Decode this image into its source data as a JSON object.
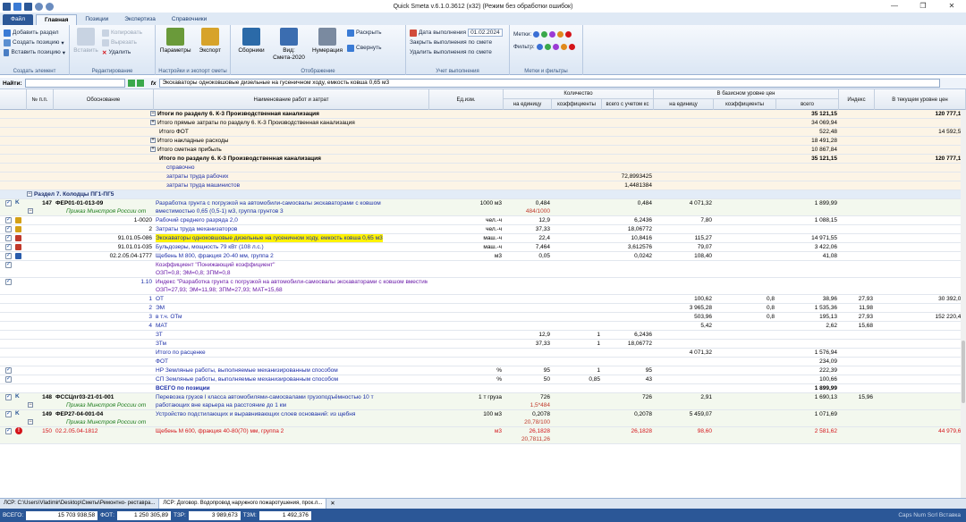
{
  "window": {
    "title": "Quick Smeta v.6.1.0.3612 (x32) (Режим без обработки ошибок)"
  },
  "ribbon_tabs": [
    "Файл",
    "Главная",
    "Позиции",
    "Экспертиза",
    "Справочники"
  ],
  "ribbon": {
    "g1": {
      "name": "Создать элемент",
      "b1": "Добавить раздел",
      "b2": "Создать позицию",
      "b3": "Вставить позицию"
    },
    "g2": {
      "name": "Редактирование",
      "paste": "Вставить",
      "copy": "Копировать",
      "cut": "Вырезать",
      "del": "Удалить"
    },
    "g3": {
      "name": "Настройки и экспорт сметы",
      "params": "Параметры",
      "export": "Экспорт"
    },
    "g4": {
      "name": "Отображение",
      "coll": "Сборники",
      "view": "Вид:",
      "view_val": "Смета-2020",
      "num": "Нумерация",
      "expand": "Раскрыть",
      "collapse": "Свернуть"
    },
    "g5": {
      "name": "Учет выполнения",
      "date_label": "Дата выполнения",
      "date_val": "01.02.2024",
      "close": "Закрыть выполнения по смете",
      "remove": "Удалить выполнения по смете"
    },
    "g6": {
      "name": "Метки и фильтры",
      "marks": "Метки:",
      "filter": "Фильтр:"
    }
  },
  "find": {
    "label": "Найти:",
    "fx": "fx",
    "formula": "Экскаваторы одноковшовые дизельные на гусеничном ходу, емкость ковша 0,65 м3"
  },
  "headers": {
    "num": "№ п.п.",
    "basis": "Обоснование",
    "name": "Наименование работ и затрат",
    "unit": "Ед.изм.",
    "qty": "Количество",
    "qty_unit": "на единицу",
    "qty_coef": "коэффициенты",
    "qty_total": "всего с учетом кс",
    "base": "В базисном уровне цен",
    "base_unit": "на единицу",
    "base_coef": "коэффициенты",
    "base_total": "всего",
    "index": "Индекс",
    "cur": "В текущем уровне цен"
  },
  "rows": [
    {
      "t": "s",
      "name": "Итоги по разделу 6. К-3 Производственная канализация",
      "bt": "35 121,15",
      "cur": "120 777,15",
      "bold": true,
      "exp": "-"
    },
    {
      "t": "s",
      "name": "Итого прямые затраты по разделу 6. К-3 Производственная канализация",
      "bt": "34 069,94",
      "exp": "+"
    },
    {
      "t": "s",
      "name": "Итого ФОТ",
      "bt": "522,48",
      "cur": "14 592,51"
    },
    {
      "t": "s",
      "name": "Итого накладные расходы",
      "bt": "18 491,28",
      "exp": "+"
    },
    {
      "t": "s",
      "name": "Итого сметная прибыль",
      "bt": "10 867,84",
      "exp": "+"
    },
    {
      "t": "s",
      "name": "Итого по разделу 6. К-3 Производственная канализация",
      "bt": "35 121,15",
      "cur": "120 777,15",
      "bold": true
    },
    {
      "t": "ref",
      "name": "справочно"
    },
    {
      "t": "ref",
      "name": "затраты труда рабочих",
      "qt": "72,8993425"
    },
    {
      "t": "ref",
      "name": "затраты труда машинистов",
      "qt": "1,4481384"
    },
    {
      "t": "sec",
      "name": "Раздел 7. Колодцы ПГ1-ПГ5"
    },
    {
      "t": "pos",
      "num": "147",
      "basis": "ФЕР01-01-013-09",
      "sub": "Приказ Минстроя России от",
      "name": "Разработка грунта с погрузкой на автомобили-самосвалы экскаваторами с ковшом",
      "name2": "вместимостью 0,65 (0,5-1) м3, группа грунтов 3",
      "unit": "1000 м3",
      "qu": "0,484",
      "qu2": "484/1000",
      "qt": "0,484",
      "bu": "4 071,32",
      "bt": "1 899,99",
      "h": 2
    },
    {
      "t": "res",
      "basis": "1-0020",
      "name": "Рабочий среднего разряда 2,0",
      "unit": "чел.-ч",
      "qu": "12,9",
      "qt": "6,2436",
      "bu": "7,80",
      "bt": "1 088,15",
      "ic": "#d4a017"
    },
    {
      "t": "res",
      "basis": "2",
      "name": "Затраты труда механизаторов",
      "unit": "чел.-ч",
      "qu": "37,33",
      "qt": "18,06772",
      "ic": "#d4a017"
    },
    {
      "t": "res",
      "basis": "91.01.05-086",
      "name": "Экскаваторы одноковшовые дизельные на гусеничном ходу, емкость ковша 0,65 м3",
      "unit": "маш.-ч",
      "qu": "22,4",
      "qt": "10,8416",
      "bu": "115,27",
      "bt": "14 971,55",
      "ic": "#c0392b",
      "hl": true
    },
    {
      "t": "res",
      "basis": "91.01.01-035",
      "name": "Бульдозеры, мощность 79 кВт (108 л.с.)",
      "unit": "маш.-ч",
      "qu": "7,464",
      "qt": "3,612576",
      "bu": "79,07",
      "bt": "3 422,06",
      "ic": "#c0392b"
    },
    {
      "t": "res",
      "basis": "02.2.05.04-1777",
      "name": "Щебень М 800, фракция 20-40 мм, группа 2",
      "unit": "м3",
      "qu": "0,05",
      "qt": "0,0242",
      "bu": "108,40",
      "bt": "41,08",
      "ic": "#2a5cab"
    },
    {
      "t": "coef",
      "name": "Коэффициент \"Понижающий коэффициент\"",
      "name2": "ОЗП=0,8; ЭМ=0,8; ЗПМ=0,8",
      "h": 2
    },
    {
      "t": "coef",
      "basis": "1.10",
      "name": "Индекс \"Разработка грунта с погрузкой на автомобили-самосвалы экскаваторами с ковшом вместимостью 1; 0,65; 0,5 м3\"",
      "name2": "ОЗП=27,93; ЭМ=11,98; ЗПМ=27,93; МАТ=15,68",
      "h": 2
    },
    {
      "t": "calc",
      "basis": "1",
      "name": "ОТ",
      "bu": "100,62",
      "bc": "0,8",
      "bt": "38,96",
      "idx": "27,93",
      "cur": "30 392,03"
    },
    {
      "t": "calc",
      "basis": "2",
      "name": "ЭМ",
      "bu": "3 965,28",
      "bc": "0,8",
      "bt": "1 535,36",
      "idx": "11,98"
    },
    {
      "t": "calc",
      "basis": "3",
      "name": "в т.ч. ОТм",
      "bu": "503,96",
      "bc": "0,8",
      "bt": "195,13",
      "idx": "27,93",
      "cur": "152 220,46"
    },
    {
      "t": "calc",
      "basis": "4",
      "name": "МАТ",
      "bu": "5,42",
      "bt": "2,62",
      "idx": "15,68"
    },
    {
      "t": "calc",
      "name": "ЗТ",
      "qu": "12,9",
      "qc": "1",
      "qt": "6,2436"
    },
    {
      "t": "calc",
      "name": "ЗТм",
      "qu": "37,33",
      "qc": "1",
      "qt": "18,06772"
    },
    {
      "t": "calc",
      "name": "Итого по расценке",
      "bu": "4 071,32",
      "bt": "1 576,94"
    },
    {
      "t": "calc",
      "name": "ФОТ",
      "bt": "234,09"
    },
    {
      "t": "calc",
      "name": "НР Земляные работы, выполняемые механизированным способом",
      "unit": "%",
      "qu": "95",
      "qc": "1",
      "qt": "95",
      "bt": "222,39",
      "chk": true
    },
    {
      "t": "calc",
      "name": "СП Земляные работы, выполняемые механизированным способом",
      "unit": "%",
      "qu": "50",
      "qc": "0,85",
      "qt": "43",
      "bt": "100,66",
      "chk": true
    },
    {
      "t": "tot",
      "name": "ВСЕГО по позиции",
      "bt": "1 899,99"
    },
    {
      "t": "pos",
      "num": "148",
      "basis": "ФССЦпг03-21-01-001",
      "sub": "Приказ Минстроя России от",
      "name": "Перевозка грузов I класса автомобилями-самосвалами грузоподъёмностью 10 т",
      "name2": "работающих вне карьера на расстояние до 1 км",
      "unit": "1 т груза",
      "qu": "726",
      "qu2": "1,5*484",
      "qt": "726",
      "bu": "2,91",
      "bt": "1 690,13",
      "idx": "15,96",
      "h": 2
    },
    {
      "t": "pos",
      "num": "149",
      "basis": "ФЕР27-04-001-04",
      "sub": "Приказ Минстроя России от",
      "name": "Устройство подстилающих и выравнивающих слоев оснований: из щебня",
      "unit": "100 м3",
      "qu": "0,2078",
      "qu2": "20,78/100",
      "qt": "0,2078",
      "bu": "5 459,07",
      "bt": "1 071,69",
      "h": 2
    },
    {
      "t": "err",
      "num": "150",
      "basis": "02.2.05.04-1812",
      "name": "Щебень М 600, фракция 40-80(70) мм, группа 2",
      "unit": "м3",
      "qu": "26,1828",
      "qu2": "20,7811,26",
      "qt": "26,1828",
      "bu": "98,60",
      "bt": "2 581,62",
      "cur": "44 979,64",
      "h": 2
    }
  ],
  "doc_tabs": [
    "ЛСР: C:\\Users\\Vladimir\\Desktop\\Сметы\\Ремонтно- реставра...",
    "ЛСР: Договор. Водопровод наружного пожаротушения, прок.л..."
  ],
  "status": {
    "total_label": "ВСЕГО:",
    "total": "15 703 938,58",
    "fot_label": "ФОТ:",
    "fot": "1 250 305,89",
    "tzr_label": "ТЗР:",
    "tzr": "3 989,673",
    "tzm_label": "ТЗМ:",
    "tzm": "1 492,376",
    "keys": "Caps Num Scrl Вставка"
  }
}
